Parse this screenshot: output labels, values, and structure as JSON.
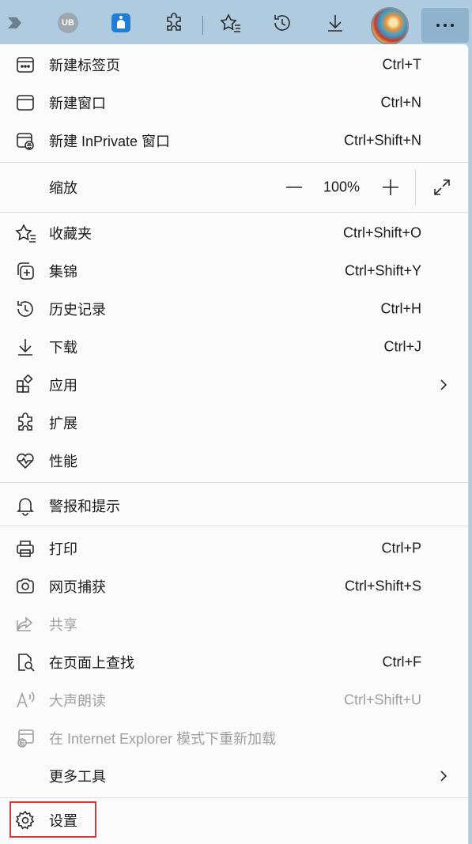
{
  "toolbar": {
    "icons": [
      "pin-icon",
      "ublock-icon",
      "bird-icon",
      "extensions-icon",
      "favorites-icon",
      "history-icon",
      "downloads-icon",
      "profile-avatar",
      "more-icon"
    ],
    "ublock_text": "UB"
  },
  "menu": {
    "new_tab": {
      "label": "新建标签页",
      "shortcut": "Ctrl+T"
    },
    "new_window": {
      "label": "新建窗口",
      "shortcut": "Ctrl+N"
    },
    "new_inprivate": {
      "label": "新建 InPrivate 窗口",
      "shortcut": "Ctrl+Shift+N"
    },
    "zoom": {
      "label": "缩放",
      "value": "100%"
    },
    "favorites": {
      "label": "收藏夹",
      "shortcut": "Ctrl+Shift+O"
    },
    "collections": {
      "label": "集锦",
      "shortcut": "Ctrl+Shift+Y"
    },
    "history": {
      "label": "历史记录",
      "shortcut": "Ctrl+H"
    },
    "downloads": {
      "label": "下载",
      "shortcut": "Ctrl+J"
    },
    "apps": {
      "label": "应用"
    },
    "extensions": {
      "label": "扩展"
    },
    "performance": {
      "label": "性能"
    },
    "alerts": {
      "label": "警报和提示"
    },
    "print": {
      "label": "打印",
      "shortcut": "Ctrl+P"
    },
    "web_capture": {
      "label": "网页捕获",
      "shortcut": "Ctrl+Shift+S"
    },
    "share": {
      "label": "共享"
    },
    "find": {
      "label": "在页面上查找",
      "shortcut": "Ctrl+F"
    },
    "read_aloud": {
      "label": "大声朗读",
      "shortcut": "Ctrl+Shift+U"
    },
    "ie_mode": {
      "label": "在 Internet Explorer 模式下重新加载"
    },
    "more_tools": {
      "label": "更多工具"
    },
    "settings": {
      "label": "设置"
    }
  },
  "colors": {
    "toolbar_bg": "#aecbe0",
    "menu_bg": "#fbfbfb",
    "highlight": "#d33a3a",
    "disabled": "#a0a0a0"
  }
}
